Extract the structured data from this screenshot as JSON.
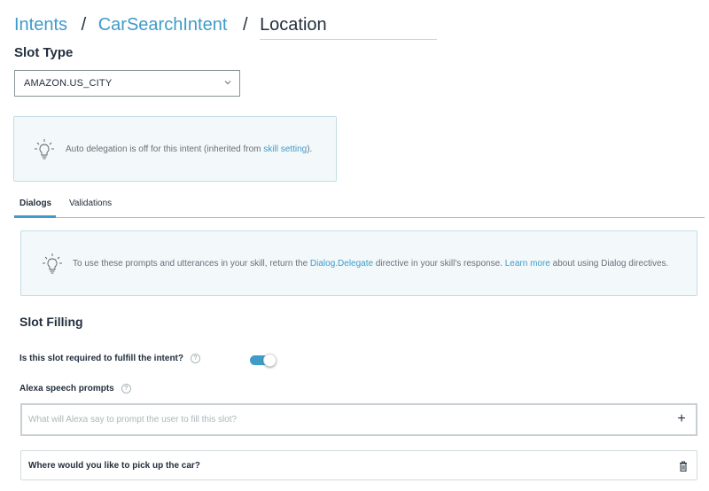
{
  "breadcrumb": {
    "items": [
      "Intents",
      "CarSearchIntent"
    ],
    "separator": "/",
    "current": "Location"
  },
  "slot_type": {
    "title": "Slot Type",
    "selected": "AMAZON.US_CITY"
  },
  "auto_delegation": {
    "icon": "lightbulb-icon",
    "text_before": "Auto delegation is off for this intent (inherited from ",
    "link": "skill setting",
    "text_after": ")."
  },
  "tabs": [
    {
      "label": "Dialogs",
      "active": true
    },
    {
      "label": "Validations",
      "active": false
    }
  ],
  "dialog_info": {
    "icon": "lightbulb-icon",
    "text_1": "To use these prompts and utterances in your skill, return the ",
    "link_1": "Dialog.Delegate",
    "text_2": " directive in your skill's response. ",
    "link_2": "Learn more",
    "text_3": " about using Dialog directives."
  },
  "slot_filling": {
    "title": "Slot Filling",
    "required_question": "Is this slot required to fulfill the intent?",
    "required": true,
    "prompts_label": "Alexa speech prompts",
    "prompt_placeholder": "What will Alexa say to prompt the user to fill this slot?",
    "prompts": [
      "Where would you like to pick up the car?"
    ]
  },
  "colors": {
    "accent": "#3f9bc8",
    "text": "#232f3e",
    "info_bg": "#f3f8fb"
  }
}
